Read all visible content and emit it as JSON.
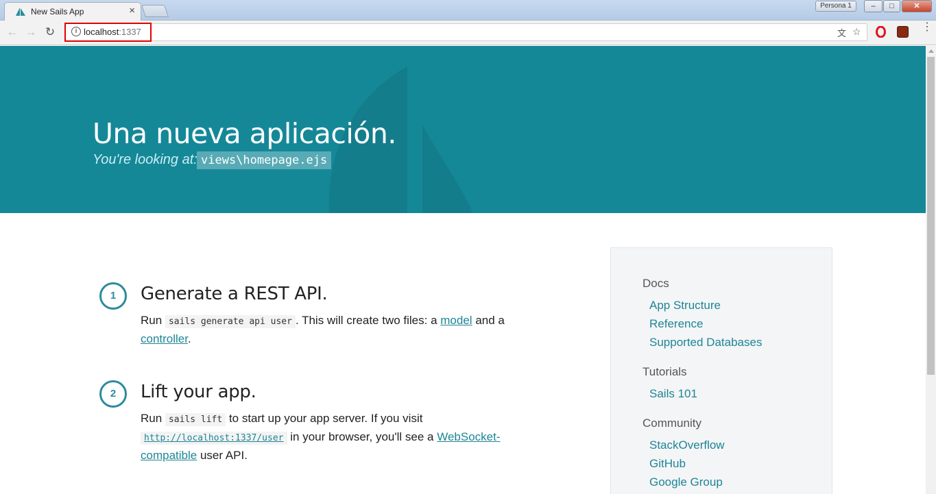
{
  "browser": {
    "tab_title": "New Sails App",
    "tab_close": "×",
    "persona_label": "Persona 1",
    "url_host": "localhost",
    "url_port": ":1337",
    "icons": [
      "back-arrow-icon",
      "forward-arrow-icon",
      "reload-icon",
      "info-icon",
      "translate-icon",
      "star-icon",
      "opera-icon",
      "extension-icon",
      "menu-icon"
    ],
    "window_buttons": {
      "minimize": "–",
      "maximize": "□",
      "close": "✕"
    }
  },
  "hero": {
    "title": "Una nueva aplicación.",
    "subtitle_prefix": "You're looking at:",
    "code_path": "views\\homepage.ejs",
    "background_color": "#158898"
  },
  "steps": [
    {
      "number": "1",
      "title": "Generate a REST API.",
      "text_run": "Run",
      "code": "sails generate api user",
      "text_mid": ". This will create two files: a",
      "link1": "model",
      "text_and": "and a",
      "link2": "controller",
      "text_end": "."
    },
    {
      "number": "2",
      "title": "Lift your app.",
      "text_run": "Run",
      "code": "sails lift",
      "text_mid": "to start up your app server. If you visit",
      "link_url": "http://localhost:1337/user",
      "text_browser": "in your browser, you'll see a",
      "link_ws": "WebSocket-compatible",
      "text_end": "user API."
    }
  ],
  "sidebar": {
    "sections": [
      {
        "heading": "Docs",
        "links": [
          "App Structure",
          "Reference",
          "Supported Databases"
        ]
      },
      {
        "heading": "Tutorials",
        "links": [
          "Sails 101"
        ]
      },
      {
        "heading": "Community",
        "links": [
          "StackOverflow",
          "GitHub",
          "Google Group"
        ]
      }
    ]
  },
  "colors": {
    "accent": "#1d8596",
    "step_circle": "#2b8b9b",
    "highlight_box": "#e00000"
  }
}
